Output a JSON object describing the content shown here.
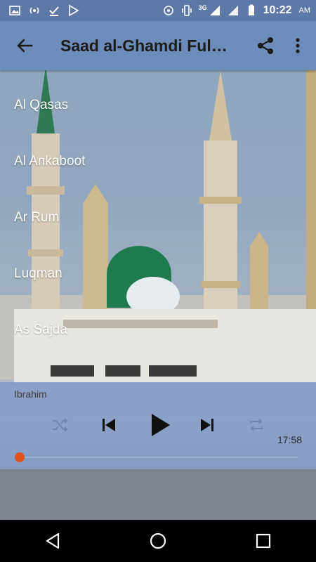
{
  "status_bar": {
    "network_label": "3G",
    "time": "10:22",
    "ampm": "AM"
  },
  "app_bar": {
    "title": "Saad al-Ghamdi Full Quran"
  },
  "list": {
    "items": [
      {
        "label": "Al Qasas"
      },
      {
        "label": "Al Ankaboot"
      },
      {
        "label": "Ar Rum"
      },
      {
        "label": "Luqman"
      },
      {
        "label": "As Sajda"
      }
    ]
  },
  "player": {
    "now_playing": "Ibrahim",
    "duration": "17:58",
    "progress": 0.0
  },
  "colors": {
    "status_bar": "#5d7aa6",
    "app_bar": "#6c8cb9",
    "seek_thumb": "#e0531e"
  }
}
